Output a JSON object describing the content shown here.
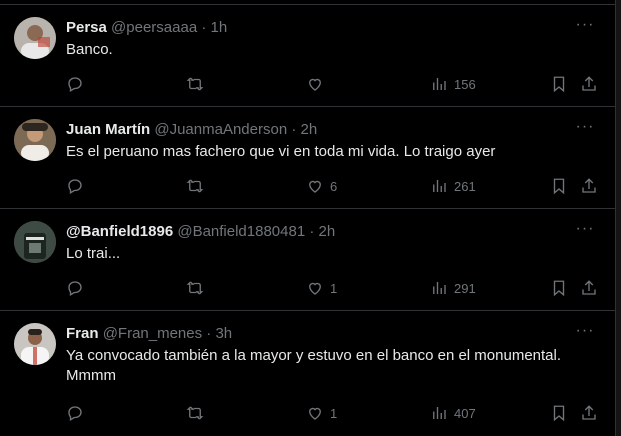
{
  "tweets": [
    {
      "name": "Persa",
      "handle": "@peersaaaa",
      "dot": "·",
      "time": "1h",
      "text": "Banco.",
      "replies": "",
      "retweets": "",
      "likes": "",
      "views": "156",
      "avatar_color": "#b9b3ad"
    },
    {
      "name": "Juan Martín",
      "handle": "@JuanmaAnderson",
      "dot": "·",
      "time": "2h",
      "text": "Es el peruano mas fachero que vi en toda mi vida. Lo traigo ayer",
      "replies": "",
      "retweets": "",
      "likes": "6",
      "views": "261",
      "avatar_color": "#7c6a55"
    },
    {
      "name": "@Banfield1896",
      "handle": "@Banfield1880481",
      "dot": "·",
      "time": "2h",
      "text": "Lo trai...",
      "replies": "",
      "retweets": "",
      "likes": "1",
      "views": "291",
      "avatar_color": "#3e4a44"
    },
    {
      "name": "Fran",
      "handle": "@Fran_menes",
      "dot": "·",
      "time": "3h",
      "text": "Ya convocado también a la mayor y estuvo en el banco en el monumental. Mmmm",
      "replies": "",
      "retweets": "",
      "likes": "1",
      "views": "407",
      "avatar_color": "#c9c6c2"
    }
  ],
  "more_glyph": "···"
}
